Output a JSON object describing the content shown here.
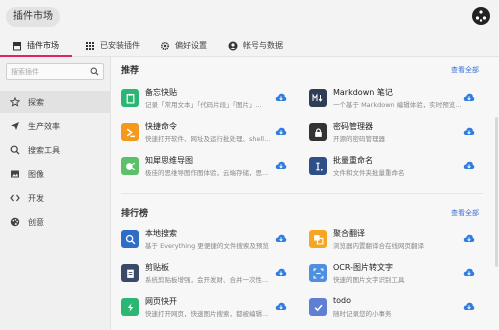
{
  "app": {
    "title": "插件市场"
  },
  "tabs": [
    {
      "label": "插件市场",
      "icon": "store-icon"
    },
    {
      "label": "已安装插件",
      "icon": "grid-icon"
    },
    {
      "label": "偏好设置",
      "icon": "gear-icon"
    },
    {
      "label": "帐号与数据",
      "icon": "user-icon"
    }
  ],
  "sidebar": {
    "search_placeholder": "搜索插件",
    "items": [
      {
        "label": "探索",
        "icon": "star-icon"
      },
      {
        "label": "生产效率",
        "icon": "send-icon"
      },
      {
        "label": "搜索工具",
        "icon": "search-icon"
      },
      {
        "label": "图像",
        "icon": "image-icon"
      },
      {
        "label": "开发",
        "icon": "code-icon"
      },
      {
        "label": "创意",
        "icon": "palette-icon"
      }
    ]
  },
  "recommend": {
    "title": "推荐",
    "see_all": "查看全部",
    "items": [
      {
        "name": "备忘快贴",
        "desc": "记录「常用文本」「代码片段」「图片」...",
        "color": "#2bb673",
        "icon": "clipboard-icon"
      },
      {
        "name": "Markdown 笔记",
        "desc": "一个基于 Markdown 编辑体验，实时预览...",
        "color": "#2f3e55",
        "icon": "markdown-icon"
      },
      {
        "name": "快捷命令",
        "desc": "快速打开软件、网址及运行批处理、shell...",
        "color": "#f39a1c",
        "icon": "command-icon"
      },
      {
        "name": "密码管理器",
        "desc": "开源的密码管理器",
        "color": "#333333",
        "icon": "lock-icon"
      },
      {
        "name": "知犀思维导图",
        "desc": "极佳的思维导图作图体验，云端存储，思...",
        "color": "#5cbf6a",
        "icon": "mindmap-icon"
      },
      {
        "name": "批量重命名",
        "desc": "文件和文件夹批量重命名",
        "color": "#2f4f88",
        "icon": "rename-icon"
      }
    ]
  },
  "ranking": {
    "title": "排行榜",
    "see_all": "查看全部",
    "items": [
      {
        "name": "本地搜索",
        "desc": "基于 Everything 更便捷的文件搜索及预览",
        "color": "#2e6cc7",
        "icon": "magnifier-icon"
      },
      {
        "name": "聚合翻译",
        "desc": "浏览器内置翻译合在线网页翻译",
        "color": "#f5a623",
        "icon": "translate-icon"
      },
      {
        "name": "剪贴板",
        "desc": "系统剪贴板增强，会开发财、合并一次性...",
        "color": "#3a4a66",
        "icon": "paste-icon"
      },
      {
        "name": "OCR-图片转文字",
        "desc": "快速的图片文字识别工具",
        "color": "#4f8fe0",
        "icon": "ocr-icon"
      },
      {
        "name": "网页快开",
        "desc": "快速打开网页，快速图片搜索，都被编辑...",
        "color": "#2bb673",
        "icon": "web-icon"
      },
      {
        "name": "todo",
        "desc": "随时记录您的小事务",
        "color": "#5e7fd4",
        "icon": "check-icon"
      }
    ]
  }
}
